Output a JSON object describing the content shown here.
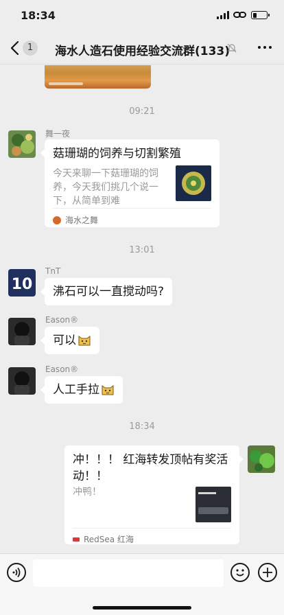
{
  "status_bar": {
    "time": "18:34"
  },
  "nav": {
    "unread_count": "1",
    "title": "海水人造石使用经验交流群(133)"
  },
  "chat": {
    "times": [
      "09:21",
      "13:01",
      "18:34"
    ],
    "messages": [
      {
        "sender": "舞一夜",
        "card_title": "菇珊瑚的饲养与切割繁殖",
        "card_desc_line1": "今天来聊一下菇珊瑚的饲",
        "card_desc_line2": "养，今天我们挑几个说一",
        "card_desc_line3": "下，从简单到难",
        "card_source": "海水之舞"
      },
      {
        "sender": "TnT",
        "text": "沸石可以一直搅动吗?"
      },
      {
        "sender": "Eason®",
        "text": "可以"
      },
      {
        "sender": "Eason®",
        "text": "人工手拉"
      },
      {
        "card_title_line1": "冲！！！ 红海转发顶帖有奖活",
        "card_title_line2": "动！！",
        "card_desc": "冲鸭！",
        "card_source": "RedSea 红海"
      }
    ]
  },
  "colors": {
    "background": "#ededed",
    "bubble": "#ffffff",
    "time_text": "#9a9a9a"
  }
}
